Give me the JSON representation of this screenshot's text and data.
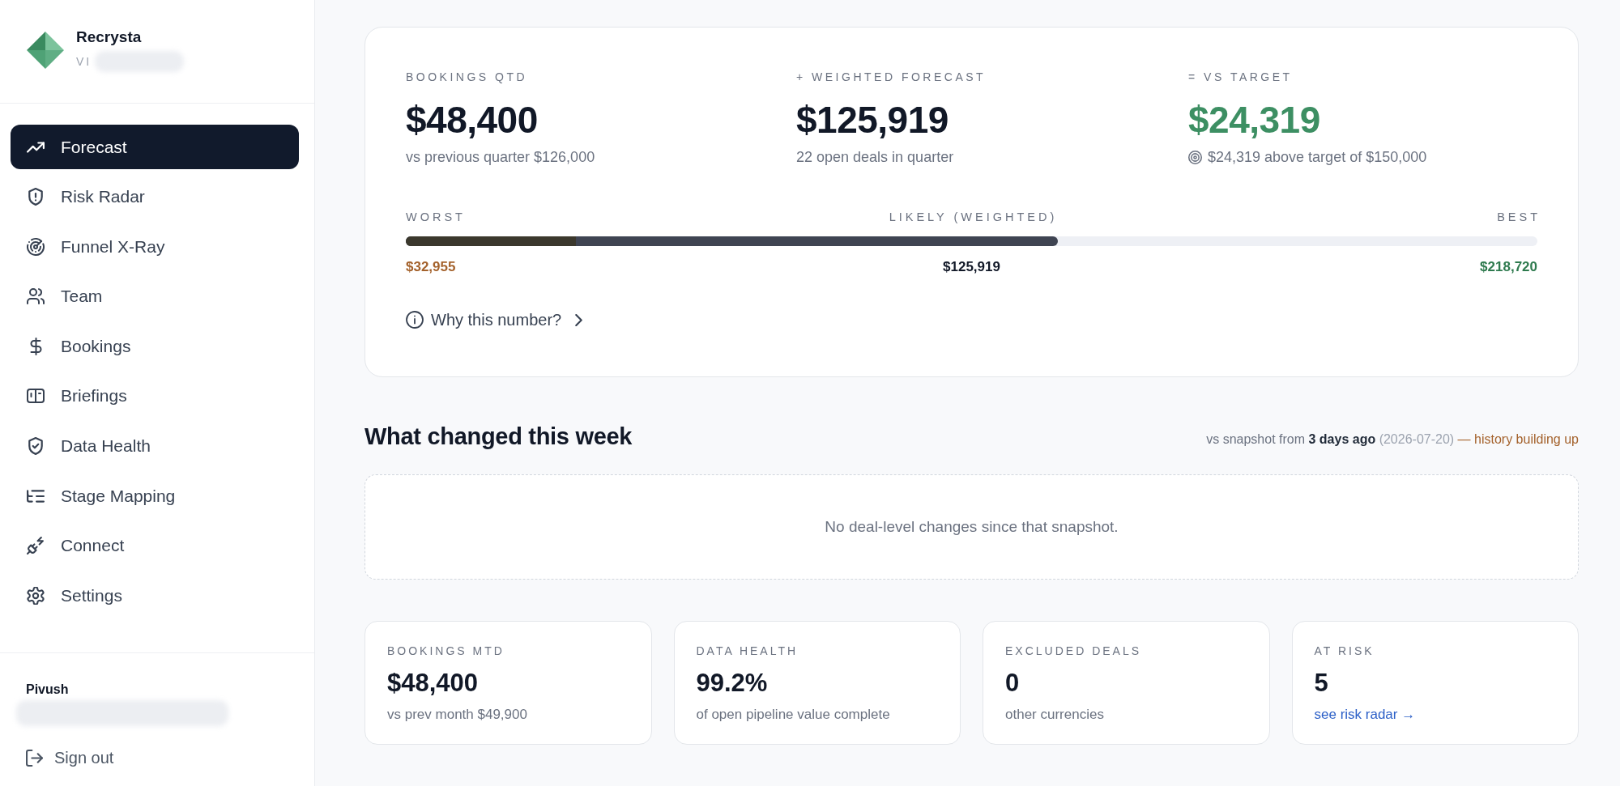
{
  "sidebar": {
    "brand": {
      "name": "Recrysta",
      "subtitle": "VI"
    },
    "nav": [
      {
        "label": "Forecast",
        "selected": true
      },
      {
        "label": "Risk Radar",
        "selected": false
      },
      {
        "label": "Funnel X-Ray",
        "selected": false
      },
      {
        "label": "Team",
        "selected": false
      },
      {
        "label": "Bookings",
        "selected": false
      },
      {
        "label": "Briefings",
        "selected": false
      },
      {
        "label": "Data Health",
        "selected": false
      },
      {
        "label": "Stage Mapping",
        "selected": false
      },
      {
        "label": "Connect",
        "selected": false
      },
      {
        "label": "Settings",
        "selected": false
      }
    ],
    "user": {
      "name": "Pivush"
    },
    "sign_out": "Sign out"
  },
  "forecast": {
    "stats": [
      {
        "kind": "plain",
        "label": "BOOKINGS QTD",
        "value": "$48,400",
        "note": "vs previous quarter $126,000"
      },
      {
        "kind": "plain",
        "label": "+ WEIGHTED FORECAST",
        "value": "$125,919",
        "note": "22 open deals in quarter"
      },
      {
        "kind": "target",
        "label": "= VS TARGET",
        "value": "$24,319",
        "note": "$24,319 above target of $150,000"
      }
    ],
    "range": {
      "points": [
        {
          "label": "WORST",
          "value": "$32,955",
          "color": "#a4622c"
        },
        {
          "label": "LIKELY (WEIGHTED)",
          "value": "$125,919",
          "color": "#111827"
        },
        {
          "label": "BEST",
          "value": "$218,720",
          "color": "#2e7a4e"
        }
      ],
      "segments": [
        {
          "level": 0.15,
          "color": "#3b382d"
        },
        {
          "level": 0.576,
          "color": "#3f4452"
        }
      ]
    },
    "why_link": "Why this number?"
  },
  "changes": {
    "title": "What changed this week",
    "snapshot": {
      "lead": "vs snapshot from",
      "age": "3 days ago",
      "date": "(2026-07-20)",
      "status": "— history building up"
    },
    "empty_message": "No deal-level changes since that snapshot."
  },
  "kpis": [
    {
      "kind": "text",
      "label": "BOOKINGS MTD",
      "value": "$48,400",
      "note": "vs prev month $49,900"
    },
    {
      "kind": "text",
      "label": "DATA HEALTH",
      "value": "99.2%",
      "note": "of open pipeline value complete"
    },
    {
      "kind": "text",
      "label": "EXCLUDED DEALS",
      "value": "0",
      "note": "other currencies"
    },
    {
      "kind": "link",
      "label": "AT RISK",
      "value": "5",
      "note": "see risk radar →"
    }
  ]
}
